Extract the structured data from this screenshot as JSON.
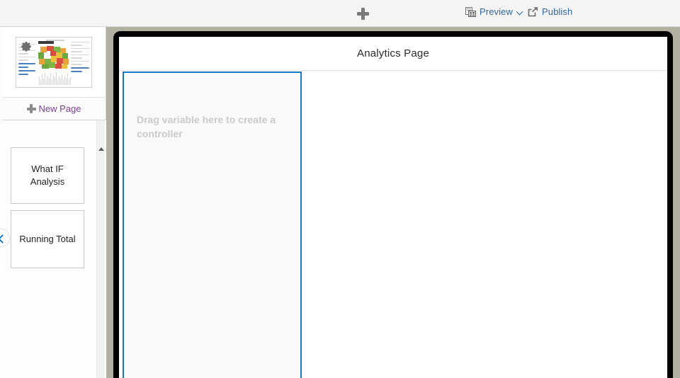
{
  "toolbar": {
    "add_icon": "plus-icon",
    "preview": {
      "label": "Preview",
      "icon": "preview-icon",
      "has_dropdown": true
    },
    "publish": {
      "label": "Publish",
      "icon": "publish-share-icon"
    },
    "link_color": "#33669a",
    "background": "#f4f4f4"
  },
  "sidebar": {
    "thumbnail": {
      "name": "page-thumbnail",
      "gear_icon": "gear-icon",
      "alt": "dashboard thumbnail preview"
    },
    "new_page": {
      "label": "New Page",
      "icon": "plus-icon",
      "color": "#7a3f8f"
    },
    "pages": [
      {
        "label": "What IF Analysis"
      },
      {
        "label": "Running Total"
      }
    ],
    "scrollbar": {
      "up_arrow_icon": "caret-up-icon"
    },
    "collapse_button": {
      "icon": "chevron-left-icon",
      "color": "#1878c8"
    }
  },
  "canvas": {
    "page_title": "Analytics Page",
    "dropzone": {
      "placeholder": "Drag variable here to create a controller",
      "border_color": "#1878c8",
      "background": "#f9f9f9"
    },
    "frame_color": "#000000"
  },
  "workspace": {
    "background": "#b3b0a1"
  }
}
